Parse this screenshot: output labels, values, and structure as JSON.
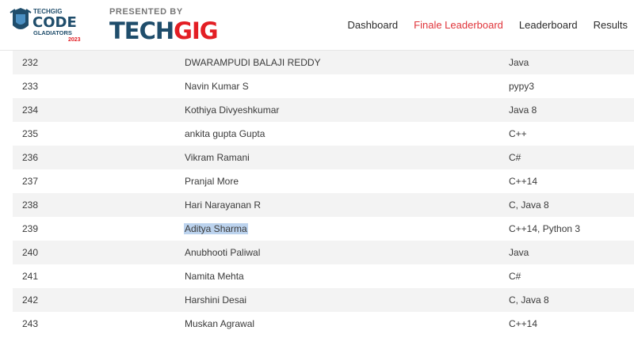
{
  "header": {
    "logo": {
      "techgig_small": "TECHGIG",
      "code": "CODE",
      "gladiators": "GLADIATORS",
      "year": "2023"
    },
    "presented_by": "PRESENTED BY",
    "brand": {
      "tech": "TECH",
      "gig": "GIG"
    },
    "nav": [
      {
        "label": "Dashboard"
      },
      {
        "label": "Finale Leaderboard"
      },
      {
        "label": "Leaderboard"
      },
      {
        "label": "Results"
      }
    ]
  },
  "colors": {
    "accent": "#e0353b",
    "brand_blue": "#1f4d6b",
    "brand_red": "#e31e24",
    "selection": "#bcd3ee"
  },
  "rows": [
    {
      "rank": "232",
      "name": "DWARAMPUDI BALAJI REDDY",
      "lang": "Java"
    },
    {
      "rank": "233",
      "name": "Navin Kumar S",
      "lang": "pypy3"
    },
    {
      "rank": "234",
      "name": "Kothiya Divyeshkumar",
      "lang": "Java 8"
    },
    {
      "rank": "235",
      "name": "ankita gupta Gupta",
      "lang": "C++"
    },
    {
      "rank": "236",
      "name": "Vikram Ramani",
      "lang": "C#"
    },
    {
      "rank": "237",
      "name": "Pranjal More",
      "lang": "C++14"
    },
    {
      "rank": "238",
      "name": "Hari Narayanan R",
      "lang": "C, Java 8"
    },
    {
      "rank": "239",
      "name": "Aditya Sharma",
      "lang": "C++14, Python 3"
    },
    {
      "rank": "240",
      "name": "Anubhooti Paliwal",
      "lang": "Java"
    },
    {
      "rank": "241",
      "name": "Namita Mehta",
      "lang": "C#"
    },
    {
      "rank": "242",
      "name": "Harshini Desai",
      "lang": "C, Java 8"
    },
    {
      "rank": "243",
      "name": "Muskan Agrawal",
      "lang": "C++14"
    }
  ]
}
